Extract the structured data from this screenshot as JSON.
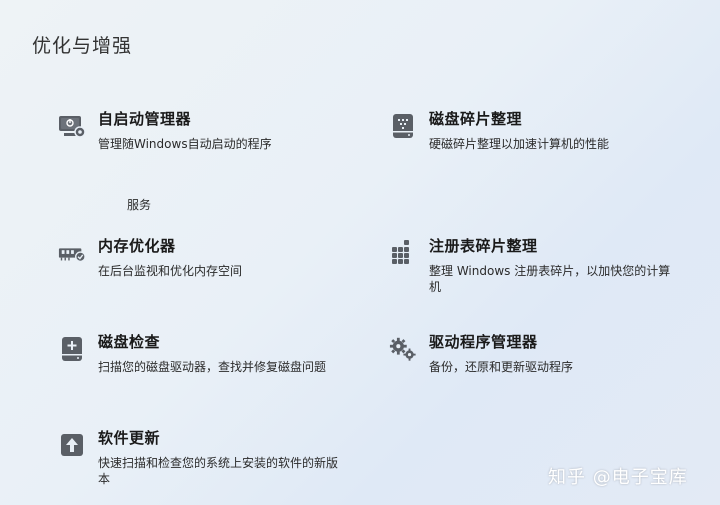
{
  "section_title": "优化与增强",
  "tools": {
    "startup": {
      "name": "自启动管理器",
      "desc": "管理随Windows自动启动的程序",
      "icon": "monitor-gear-icon"
    },
    "defrag": {
      "name": "磁盘碎片整理",
      "desc": "硬磁碎片整理以加速计算机的性能",
      "icon": "drive-defrag-icon"
    },
    "memory": {
      "name": "内存优化器",
      "desc": "在后台监视和优化内存空间",
      "icon": "ram-check-icon"
    },
    "registry": {
      "name": "注册表碎片整理",
      "desc": "整理 Windows 注册表碎片，以加快您的计算机",
      "icon": "dots-grid-icon"
    },
    "diskcheck": {
      "name": "磁盘检查",
      "desc": "扫描您的磁盘驱动器，查找并修复磁盘问题",
      "icon": "drive-plus-icon"
    },
    "drivers": {
      "name": "驱动程序管理器",
      "desc": "备份，还原和更新驱动程序",
      "icon": "gears-icon"
    },
    "update": {
      "name": "软件更新",
      "desc": "快速扫描和检查您的系统上安装的软件的新版本",
      "icon": "upload-arrow-icon"
    }
  },
  "services_label": "服务",
  "watermark": "知乎 @电子宝库",
  "colors": {
    "icon": "#5a5f66",
    "background": "#e9f0f7"
  }
}
